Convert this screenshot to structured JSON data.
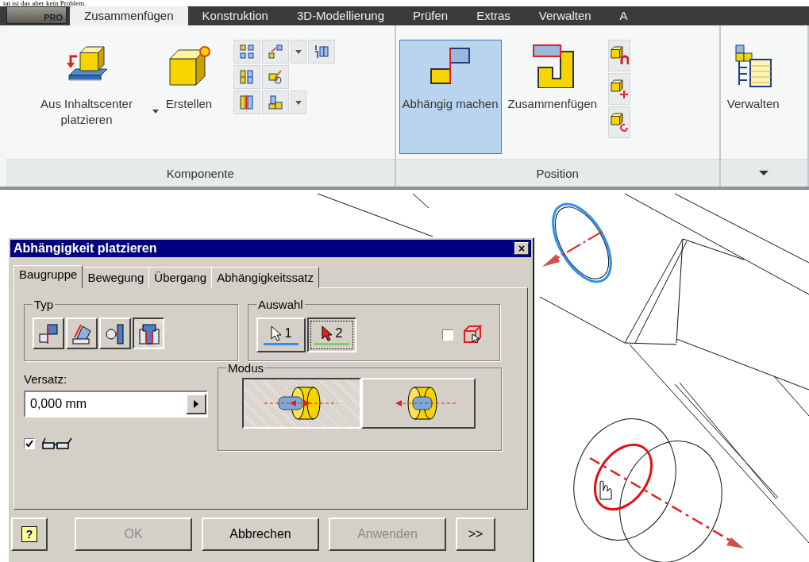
{
  "header_text": "tat ist das aber kein Problem.",
  "ribbon": {
    "app_button": "PRO",
    "tabs": [
      {
        "label": "Zusammenfügen",
        "selected": true
      },
      {
        "label": "Konstruktion",
        "selected": false
      },
      {
        "label": "3D-Modellierung",
        "selected": false
      },
      {
        "label": "Prüfen",
        "selected": false
      },
      {
        "label": "Extras",
        "selected": false
      },
      {
        "label": "Verwalten",
        "selected": false
      },
      {
        "label": "A",
        "selected": false
      }
    ],
    "groups": [
      {
        "kind": "component",
        "title": "Komponente",
        "buttons": [
          {
            "label": "Aus Inhaltscenter platzieren",
            "dropdown": true,
            "selected": false
          },
          {
            "label": "Erstellen",
            "dropdown": false,
            "selected": false
          }
        ]
      },
      {
        "kind": "position",
        "title": "Position",
        "buttons": [
          {
            "label": "Abhängig machen",
            "dropdown": false,
            "selected": true
          },
          {
            "label": "Zusammenfügen",
            "dropdown": false,
            "selected": false
          }
        ]
      },
      {
        "kind": "manage",
        "buttons": [
          {
            "label": "Verwalten",
            "dropdown": false,
            "selected": false
          }
        ]
      }
    ]
  },
  "dialog": {
    "title": "Abhängigkeit platzieren",
    "close": "×",
    "tabs": [
      {
        "label": "Baugruppe",
        "selected": true
      },
      {
        "label": "Bewegung",
        "selected": false
      },
      {
        "label": "Übergang",
        "selected": false
      },
      {
        "label": "Abhängigkeitssatz",
        "selected": false
      }
    ],
    "type_group": {
      "title": "Typ",
      "options": [
        {
          "kind": "mate",
          "selected": false
        },
        {
          "kind": "angle",
          "selected": false
        },
        {
          "kind": "tangent",
          "selected": false
        },
        {
          "kind": "insert",
          "selected": true
        }
      ]
    },
    "selection_group": {
      "title": "Auswahl",
      "picks": [
        {
          "label": "1",
          "selected": false
        },
        {
          "label": "2",
          "selected": true
        }
      ],
      "preselect": {
        "checked": false
      }
    },
    "offset": {
      "label": "Versatz:",
      "value": "0,000 mm"
    },
    "preview": {
      "checked": true
    },
    "mode_group": {
      "title": "Modus",
      "options": [
        {
          "kind": "opposed",
          "selected": true
        },
        {
          "kind": "aligned",
          "selected": false
        }
      ]
    },
    "buttons": [
      {
        "kind": "help",
        "label": "?",
        "disabled": false
      },
      {
        "kind": "text",
        "label": "OK",
        "disabled": true
      },
      {
        "kind": "text",
        "label": "Abbrechen",
        "disabled": false
      },
      {
        "kind": "text",
        "label": "Anwenden",
        "disabled": true
      },
      {
        "kind": "text",
        "label": ">>",
        "disabled": false
      }
    ]
  }
}
